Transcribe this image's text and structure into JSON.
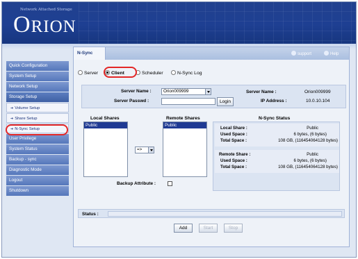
{
  "banner": {
    "tagline": "Network Attached Storage",
    "logo_initial": "O",
    "logo_rest": "RION"
  },
  "sidebar": {
    "items": [
      {
        "label": "Quick Configuration",
        "type": "main"
      },
      {
        "label": "System Setup",
        "type": "main"
      },
      {
        "label": "Network Setup",
        "type": "main"
      },
      {
        "label": "Storage Setup",
        "type": "main"
      },
      {
        "label": "Volume Setup",
        "type": "sub"
      },
      {
        "label": "Share Setup",
        "type": "sub"
      },
      {
        "label": "N-Sync Setup",
        "type": "sub",
        "selected": true
      },
      {
        "label": "User Privilege",
        "type": "main"
      },
      {
        "label": "System Status",
        "type": "main"
      },
      {
        "label": "Backup - sync",
        "type": "main"
      },
      {
        "label": "Diagnostic Mode",
        "type": "main"
      },
      {
        "label": "Logout",
        "type": "main"
      },
      {
        "label": "Shutdown",
        "type": "main"
      }
    ]
  },
  "tab": {
    "label": "N-Sync"
  },
  "toplinks": {
    "support": "support",
    "help": "Help"
  },
  "mode": {
    "server": "Server",
    "client": "Client",
    "scheduler": "Scheduler",
    "log": "N-Sync Log",
    "selected": "Client"
  },
  "login": {
    "server_name_label": "Server Name :",
    "server_name_value": "Orion009999",
    "server_passwd_label": "Server Passwd :",
    "login_button": "Login",
    "right_server_name_label": "Server Name :",
    "right_server_name_value": "Orion009999",
    "ip_label": "IP Address :",
    "ip_value": "10.0.10.104"
  },
  "shares": {
    "local_header": "Local Shares",
    "remote_header": "Remote Shares",
    "status_header": "N-Sync Status",
    "local_items": [
      "Public"
    ],
    "remote_items": [
      "Public"
    ],
    "direction": "=>"
  },
  "status": {
    "local": {
      "share_label": "Local Share :",
      "share_value": "Public",
      "used_label": "Used Space :",
      "used_value": "6 bytes, (6 bytes)",
      "total_label": "Total Space :",
      "total_value": "108 GB, (116454064128 bytes)"
    },
    "remote": {
      "share_label": "Remote Share :",
      "share_value": "Public",
      "used_label": "Used Space :",
      "used_value": "6 bytes, (6 bytes)",
      "total_label": "Total Space :",
      "total_value": "108 GB, (116454064128 bytes)"
    }
  },
  "backup_attribute_label": "Backup Attribute :",
  "statusbar": {
    "label": "Status :",
    "value": ""
  },
  "buttons": {
    "add": "Add",
    "start": "Start",
    "stop": "Stop"
  },
  "colors": {
    "banner": "#1e3f92",
    "sidebar": "#5577bb",
    "accent": "#e32626",
    "selected_item": "#1f3a93"
  }
}
